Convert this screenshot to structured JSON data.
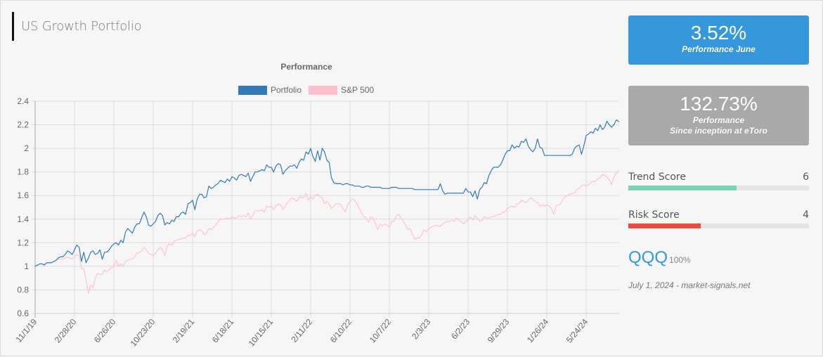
{
  "header": {
    "title": "US Growth Portfolio"
  },
  "cards": {
    "monthly": {
      "value": "3.52%",
      "label": "Performance June",
      "color": "#3498db"
    },
    "inception": {
      "value": "132.73%",
      "label_line1": "Performance",
      "label_line2": "Since inception at eToro",
      "color": "#a9a9a9"
    }
  },
  "scores": {
    "trend": {
      "label": "Trend Score",
      "value": "6",
      "fraction": 0.6,
      "color": "#7dd3b5"
    },
    "risk": {
      "label": "Risk Score",
      "value": "4",
      "fraction": 0.4,
      "color": "#e74c3c"
    }
  },
  "allocation": {
    "ticker": "QQQ",
    "weight": "100%"
  },
  "footer": {
    "text": "July 1, 2024 - market-signals.net"
  },
  "chart_data": {
    "type": "line",
    "title": "Performance",
    "xlabel": "",
    "ylabel": "",
    "ylim": [
      0.6,
      2.4
    ],
    "yticks": [
      "2.4",
      "2.2",
      "2",
      "1.8",
      "1.6",
      "1.4",
      "1.2",
      "1",
      "0.8",
      "0.6"
    ],
    "xticks": [
      "11/1/19",
      "2/28/20",
      "6/26/20",
      "10/23/20",
      "2/19/21",
      "6/18/21",
      "10/15/21",
      "2/11/22",
      "6/10/22",
      "10/7/22",
      "2/3/23",
      "6/2/23",
      "9/29/23",
      "1/26/24",
      "5/24/24"
    ],
    "x_interval_weeks": 17,
    "grid": true,
    "legend": "top-center",
    "series": [
      {
        "name": "Portfolio",
        "color": "#337ab7",
        "values": [
          1.0,
          1.01,
          1.02,
          1.02,
          1.01,
          1.03,
          1.03,
          1.03,
          1.04,
          1.05,
          1.07,
          1.08,
          1.08,
          1.1,
          1.13,
          1.12,
          1.1,
          1.14,
          1.18,
          1.16,
          1.04,
          1.12,
          1.03,
          1.07,
          1.12,
          1.13,
          1.1,
          1.11,
          1.14,
          1.06,
          1.12,
          1.12,
          1.14,
          1.17,
          1.19,
          1.2,
          1.18,
          1.22,
          1.2,
          1.29,
          1.32,
          1.3,
          1.28,
          1.33,
          1.36,
          1.36,
          1.41,
          1.46,
          1.42,
          1.35,
          1.34,
          1.36,
          1.38,
          1.43,
          1.45,
          1.43,
          1.35,
          1.37,
          1.36,
          1.39,
          1.38,
          1.42,
          1.42,
          1.45,
          1.46,
          1.44,
          1.53,
          1.54,
          1.56,
          1.48,
          1.57,
          1.61,
          1.61,
          1.58,
          1.59,
          1.68,
          1.66,
          1.67,
          1.69,
          1.7,
          1.73,
          1.72,
          1.71,
          1.74,
          1.72,
          1.76,
          1.75,
          1.73,
          1.77,
          1.78,
          1.77,
          1.76,
          1.79,
          1.72,
          1.76,
          1.8,
          1.8,
          1.81,
          1.82,
          1.81,
          1.86,
          1.84,
          1.84,
          1.8,
          1.85,
          1.87,
          1.86,
          1.78,
          1.81,
          1.83,
          1.85,
          1.85,
          1.86,
          1.83,
          1.88,
          1.91,
          1.9,
          1.97,
          1.95,
          2.0,
          1.93,
          1.89,
          1.98,
          1.9,
          2.0,
          1.97,
          1.9,
          1.88,
          1.75,
          1.71,
          1.7,
          1.7,
          1.7,
          1.69,
          1.7,
          1.7,
          1.69,
          1.69,
          1.68,
          1.68,
          1.68,
          1.67,
          1.67,
          1.68,
          1.68,
          1.67,
          1.67,
          1.67,
          1.67,
          1.67,
          1.66,
          1.66,
          1.66,
          1.66,
          1.67,
          1.67,
          1.67,
          1.66,
          1.66,
          1.66,
          1.66,
          1.66,
          1.66,
          1.66,
          1.65,
          1.65,
          1.65,
          1.65,
          1.65,
          1.65,
          1.65,
          1.65,
          1.65,
          1.65,
          1.65,
          1.7,
          1.64,
          1.61,
          1.62,
          1.62,
          1.62,
          1.62,
          1.62,
          1.62,
          1.62,
          1.62,
          1.66,
          1.63,
          1.63,
          1.59,
          1.64,
          1.57,
          1.65,
          1.67,
          1.71,
          1.7,
          1.77,
          1.81,
          1.84,
          1.84,
          1.84,
          1.86,
          1.9,
          1.95,
          1.98,
          1.98,
          2.03,
          2.0,
          2.02,
          2.01,
          2.06,
          2.05,
          2.08,
          2.02,
          1.99,
          1.97,
          2.0,
          2.08,
          2.01,
          2.0,
          1.94,
          1.94,
          1.94,
          1.94,
          1.94,
          1.94,
          1.94,
          1.94,
          1.94,
          1.94,
          1.94,
          1.94,
          1.95,
          2.0,
          2.02,
          2.03,
          1.95,
          2.02,
          2.11,
          2.12,
          2.14,
          2.13,
          2.17,
          2.15,
          2.2,
          2.16,
          2.18,
          2.23,
          2.2,
          2.18,
          2.2,
          2.24,
          2.23,
          2.21,
          2.18,
          2.1,
          2.16,
          2.19,
          2.21,
          2.22,
          2.24,
          2.21,
          2.21,
          2.23,
          2.26,
          2.28,
          2.3,
          2.3
        ]
      },
      {
        "name": "S&P 500",
        "color": "#ffc0cb",
        "values": [
          1.0,
          1.01,
          1.02,
          1.02,
          1.02,
          1.03,
          1.03,
          1.03,
          1.04,
          1.05,
          1.06,
          1.06,
          1.06,
          1.07,
          1.08,
          1.07,
          1.06,
          1.08,
          1.1,
          1.09,
          0.98,
          0.98,
          0.88,
          0.77,
          0.84,
          0.82,
          0.9,
          0.94,
          0.93,
          0.93,
          0.97,
          0.95,
          0.97,
          0.99,
          1.0,
          1.05,
          1.0,
          1.02,
          1.0,
          1.04,
          1.05,
          1.06,
          1.06,
          1.08,
          1.11,
          1.12,
          1.13,
          1.16,
          1.14,
          1.11,
          1.1,
          1.09,
          1.11,
          1.14,
          1.16,
          1.14,
          1.09,
          1.17,
          1.19,
          1.18,
          1.21,
          1.22,
          1.23,
          1.23,
          1.24,
          1.24,
          1.26,
          1.26,
          1.28,
          1.25,
          1.3,
          1.31,
          1.3,
          1.27,
          1.28,
          1.32,
          1.31,
          1.33,
          1.35,
          1.38,
          1.4,
          1.4,
          1.4,
          1.41,
          1.4,
          1.42,
          1.41,
          1.41,
          1.43,
          1.42,
          1.43,
          1.42,
          1.45,
          1.4,
          1.43,
          1.47,
          1.47,
          1.47,
          1.48,
          1.46,
          1.51,
          1.5,
          1.51,
          1.48,
          1.51,
          1.53,
          1.52,
          1.48,
          1.51,
          1.54,
          1.56,
          1.58,
          1.57,
          1.55,
          1.58,
          1.59,
          1.58,
          1.62,
          1.56,
          1.59,
          1.57,
          1.6,
          1.61,
          1.59,
          1.58,
          1.53,
          1.55,
          1.53,
          1.49,
          1.51,
          1.53,
          1.53,
          1.52,
          1.49,
          1.46,
          1.52,
          1.55,
          1.57,
          1.56,
          1.53,
          1.49,
          1.45,
          1.42,
          1.41,
          1.37,
          1.42,
          1.41,
          1.36,
          1.31,
          1.36,
          1.34,
          1.36,
          1.35,
          1.33,
          1.38,
          1.38,
          1.43,
          1.44,
          1.41,
          1.38,
          1.35,
          1.31,
          1.32,
          1.27,
          1.23,
          1.24,
          1.24,
          1.27,
          1.31,
          1.29,
          1.32,
          1.33,
          1.34,
          1.35,
          1.34,
          1.34,
          1.36,
          1.37,
          1.38,
          1.38,
          1.39,
          1.38,
          1.41,
          1.39,
          1.38,
          1.36,
          1.38,
          1.39,
          1.42,
          1.39,
          1.43,
          1.41,
          1.38,
          1.39,
          1.42,
          1.41,
          1.41,
          1.42,
          1.42,
          1.43,
          1.44,
          1.44,
          1.46,
          1.46,
          1.49,
          1.5,
          1.51,
          1.5,
          1.53,
          1.53,
          1.56,
          1.55,
          1.54,
          1.56,
          1.58,
          1.57,
          1.55,
          1.54,
          1.51,
          1.52,
          1.51,
          1.52,
          1.51,
          1.49,
          1.44,
          1.51,
          1.52,
          1.53,
          1.57,
          1.59,
          1.6,
          1.61,
          1.62,
          1.62,
          1.65,
          1.66,
          1.68,
          1.69,
          1.68,
          1.69,
          1.71,
          1.72,
          1.72,
          1.74,
          1.75,
          1.78,
          1.77,
          1.76,
          1.73,
          1.69,
          1.76,
          1.79,
          1.81,
          1.82,
          1.82,
          1.86,
          1.86,
          1.86,
          1.88,
          1.9,
          1.91,
          1.91
        ]
      }
    ]
  }
}
